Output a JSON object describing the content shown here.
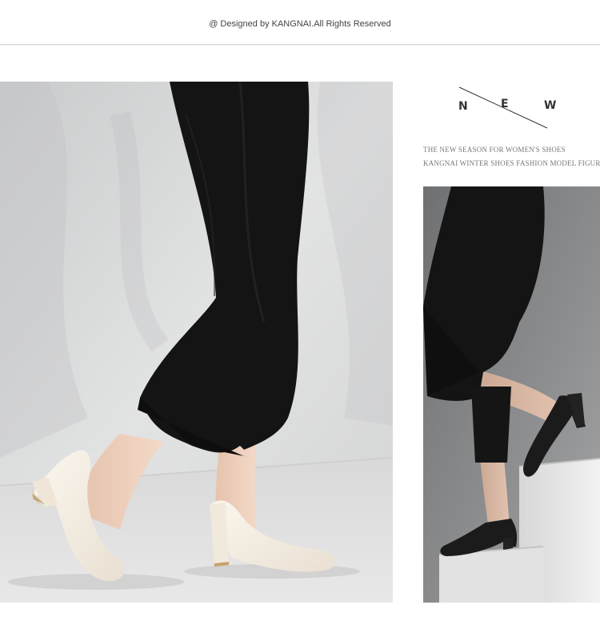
{
  "header": {
    "copyright_text": "@ Designed by KANGNAI.All Rights Reserved"
  },
  "new_heading": {
    "letters": [
      "N",
      "E",
      "W"
    ]
  },
  "taglines": [
    "THE NEW SEASON FOR WOMEN'S SHOES",
    "KANGNAI WINTER SHOES FASHION MODEL FIGURE"
  ],
  "colors": {
    "background": "#ffffff",
    "text_dark": "#333333",
    "text_muted": "#777777",
    "pants": "#151515",
    "beige_shoe": "#f3ece2",
    "black_shoe": "#1b1b1b"
  }
}
